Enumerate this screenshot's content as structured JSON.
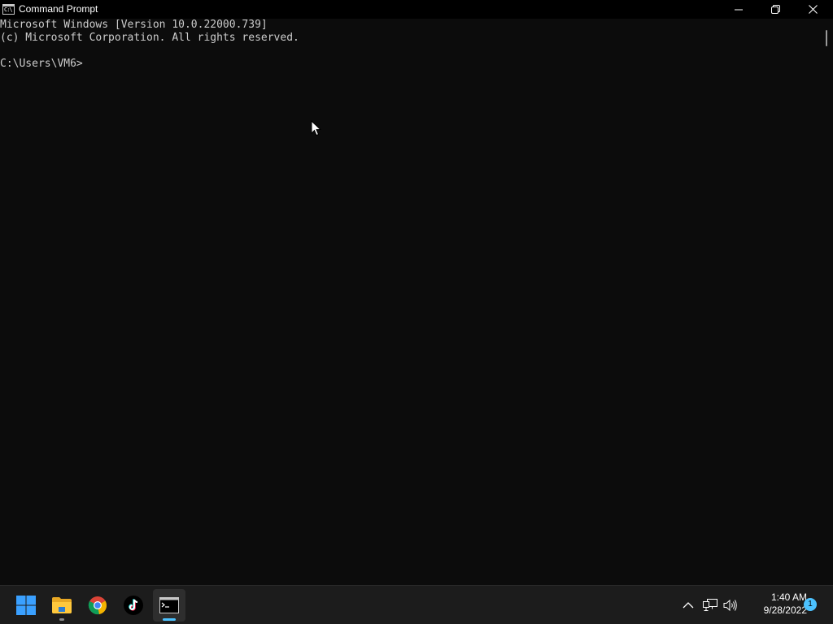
{
  "window": {
    "title": "Command Prompt",
    "app_icon_glyph": "C:\\",
    "controls": {
      "minimize": "minimize-icon",
      "maximize": "restore-icon",
      "close": "close-icon"
    }
  },
  "console": {
    "lines": [
      "Microsoft Windows [Version 10.0.22000.739]",
      "(c) Microsoft Corporation. All rights reserved.",
      "C:\\Users\\VM6>"
    ]
  },
  "taskbar": {
    "apps": [
      {
        "name": "start",
        "icon": "windows-logo-icon"
      },
      {
        "name": "file-explorer",
        "icon": "folder-icon"
      },
      {
        "name": "chrome",
        "icon": "chrome-icon"
      },
      {
        "name": "tiktok",
        "icon": "tiktok-icon"
      },
      {
        "name": "command-prompt",
        "icon": "terminal-icon",
        "active": true
      }
    ],
    "tray": {
      "icons": [
        "chevron-up-icon",
        "network-icon",
        "volume-icon"
      ],
      "time": "1:40 AM",
      "date": "9/28/2022",
      "notification_count": "1"
    }
  },
  "colors": {
    "console_bg": "#0c0c0c",
    "console_text": "#cccccc",
    "taskbar_bg": "#1c1c1c",
    "accent": "#4cc2ff"
  }
}
